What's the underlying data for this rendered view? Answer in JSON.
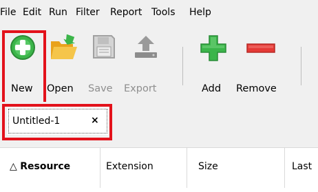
{
  "menu": [
    "File",
    "Edit",
    "Run",
    "Filter",
    "Report",
    "Tools",
    "Help"
  ],
  "toolbar": {
    "new_label": "New",
    "open_label": "Open",
    "save_label": "Save",
    "export_label": "Export",
    "add_label": "Add",
    "remove_label": "Remove"
  },
  "tabs": [
    {
      "label": "Untitled-1",
      "close": "×"
    }
  ],
  "table": {
    "sort_indicator": "△",
    "columns": [
      "Resource",
      "Extension",
      "Size",
      "Last"
    ]
  },
  "colors": {
    "highlight": "#e3121b",
    "new_green": "#3cb54a",
    "add_green": "#3bb54a",
    "remove_red": "#e53935",
    "folder_orange": "#f5b32b"
  }
}
